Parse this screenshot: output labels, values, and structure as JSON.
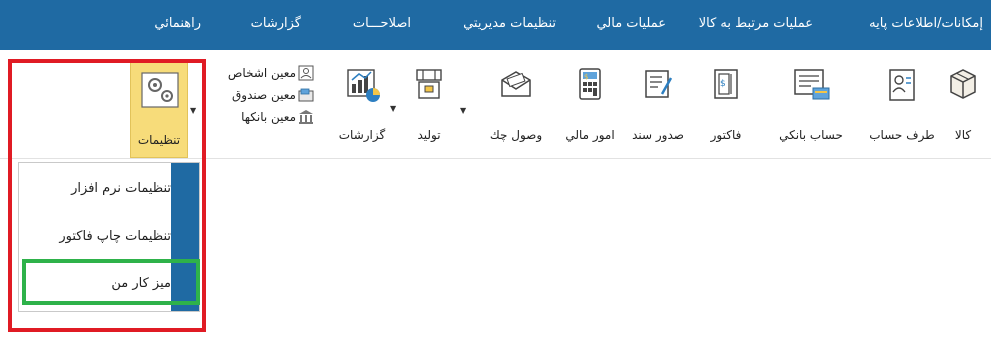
{
  "menubar": {
    "items": [
      {
        "label": "إمكانات/اطلاعات پايه"
      },
      {
        "label": "عمليات مرتبط به كالا"
      },
      {
        "label": "عمليات مالي"
      },
      {
        "label": "تنظيمات مديريتي"
      },
      {
        "label": "اصلاحـــات"
      },
      {
        "label": "گزارشات"
      },
      {
        "label": "راهنمائي"
      }
    ]
  },
  "ribbon": {
    "buttons": [
      {
        "label": "كالا",
        "icon": "box-icon"
      },
      {
        "label": "طرف حساب",
        "icon": "contact-card-icon"
      },
      {
        "label": "حساب بانكي",
        "icon": "bank-card-icon"
      },
      {
        "label": "فاكتور",
        "icon": "invoice-icon"
      },
      {
        "label": "صدور سند",
        "icon": "document-edit-icon"
      },
      {
        "label": "امور مالي",
        "icon": "calculator-icon"
      },
      {
        "label": "وصول چك",
        "icon": "envelope-check-icon"
      },
      {
        "label": "توليد",
        "icon": "production-icon"
      },
      {
        "label": "گزارشات",
        "icon": "chart-icon"
      }
    ],
    "small_items": [
      {
        "label": "معين اشخاص",
        "icon": "people-icon"
      },
      {
        "label": "معين صندوق",
        "icon": "cashbox-icon"
      },
      {
        "label": "معين بانكها",
        "icon": "bank-icon"
      }
    ],
    "settings": {
      "label": "تنظيمات",
      "icon": "gears-icon"
    }
  },
  "dropdown": {
    "items": [
      {
        "label": "تنظيمات نرم افزار"
      },
      {
        "label": "تنظيمات چاپ فاكتور"
      },
      {
        "label": "ميز كار من"
      }
    ]
  },
  "colors": {
    "menubar_bg": "#1f6aa3",
    "settings_highlight": "#f7dc7a",
    "annotation_red": "#e01b24",
    "annotation_green": "#2eb24a"
  }
}
